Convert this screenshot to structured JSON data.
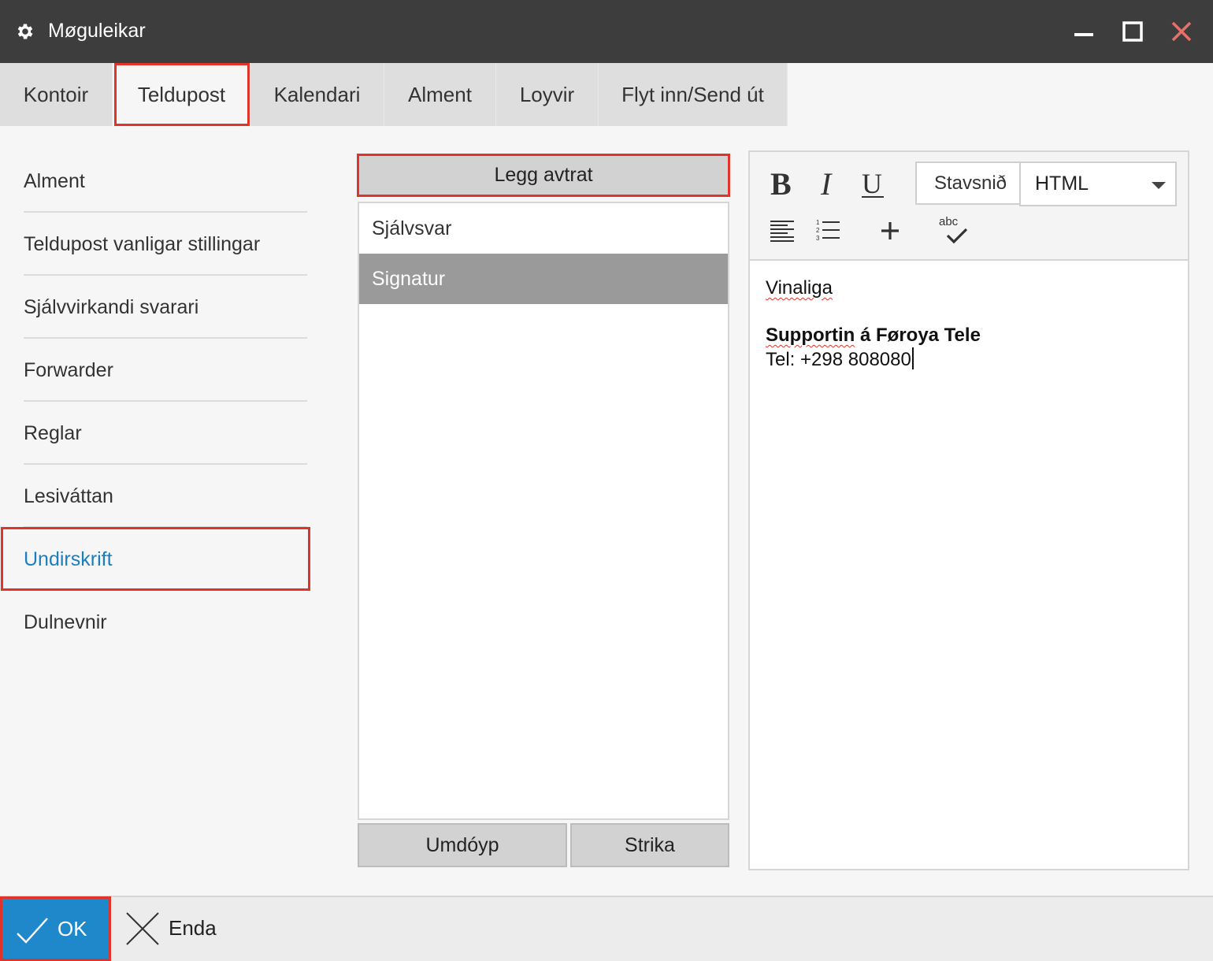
{
  "window": {
    "title": "Møguleikar",
    "icons": {
      "title": "gear-icon",
      "minimize": "minimize-icon",
      "maximize": "maximize-icon",
      "close": "close-icon"
    },
    "close_color": "#e8706a"
  },
  "tabs": [
    {
      "label": "Kontoir",
      "active": false
    },
    {
      "label": "Teldupost",
      "active": true
    },
    {
      "label": "Kalendari",
      "active": false
    },
    {
      "label": "Alment",
      "active": false
    },
    {
      "label": "Loyvir",
      "active": false
    },
    {
      "label": "Flyt inn/Send út",
      "active": false
    }
  ],
  "sidebar": {
    "items": [
      {
        "label": "Alment",
        "active": false
      },
      {
        "label": "Teldupost vanligar stillingar",
        "active": false
      },
      {
        "label": "Sjálvvirkandi svarari",
        "active": false
      },
      {
        "label": "Forwarder",
        "active": false
      },
      {
        "label": "Reglar",
        "active": false
      },
      {
        "label": "Lesiváttan",
        "active": false
      },
      {
        "label": "Undirskrift",
        "active": true
      },
      {
        "label": "Dulnevnir",
        "active": false
      }
    ]
  },
  "signatures": {
    "add_label": "Legg avtrat",
    "items": [
      {
        "label": "Sjálvsvar",
        "selected": false
      },
      {
        "label": "Signatur",
        "selected": true
      }
    ],
    "rename_label": "Umdóyp",
    "delete_label": "Strika"
  },
  "editor": {
    "toolbar": {
      "icons": [
        "bold-icon",
        "italic-icon",
        "underline-icon",
        "align-left-icon",
        "numbered-list-icon",
        "plus-icon",
        "spellcheck-icon"
      ],
      "spellcheck_label": "abc",
      "stavsnid_label": "Stavsnið",
      "format_value": "HTML"
    },
    "content": {
      "line1": "Vinaliga",
      "line2_prefix": "Supportin",
      "line2_suffix": " á Føroya Tele",
      "line3": "Tel: +298 808080"
    }
  },
  "footer": {
    "ok_label": "OK",
    "cancel_label": "Enda",
    "icons": {
      "ok": "check-icon",
      "cancel": "x-icon"
    },
    "ok_color": "#1f88cb"
  },
  "accent_color": "#1a7fc1",
  "highlight_color": "#e0342a"
}
